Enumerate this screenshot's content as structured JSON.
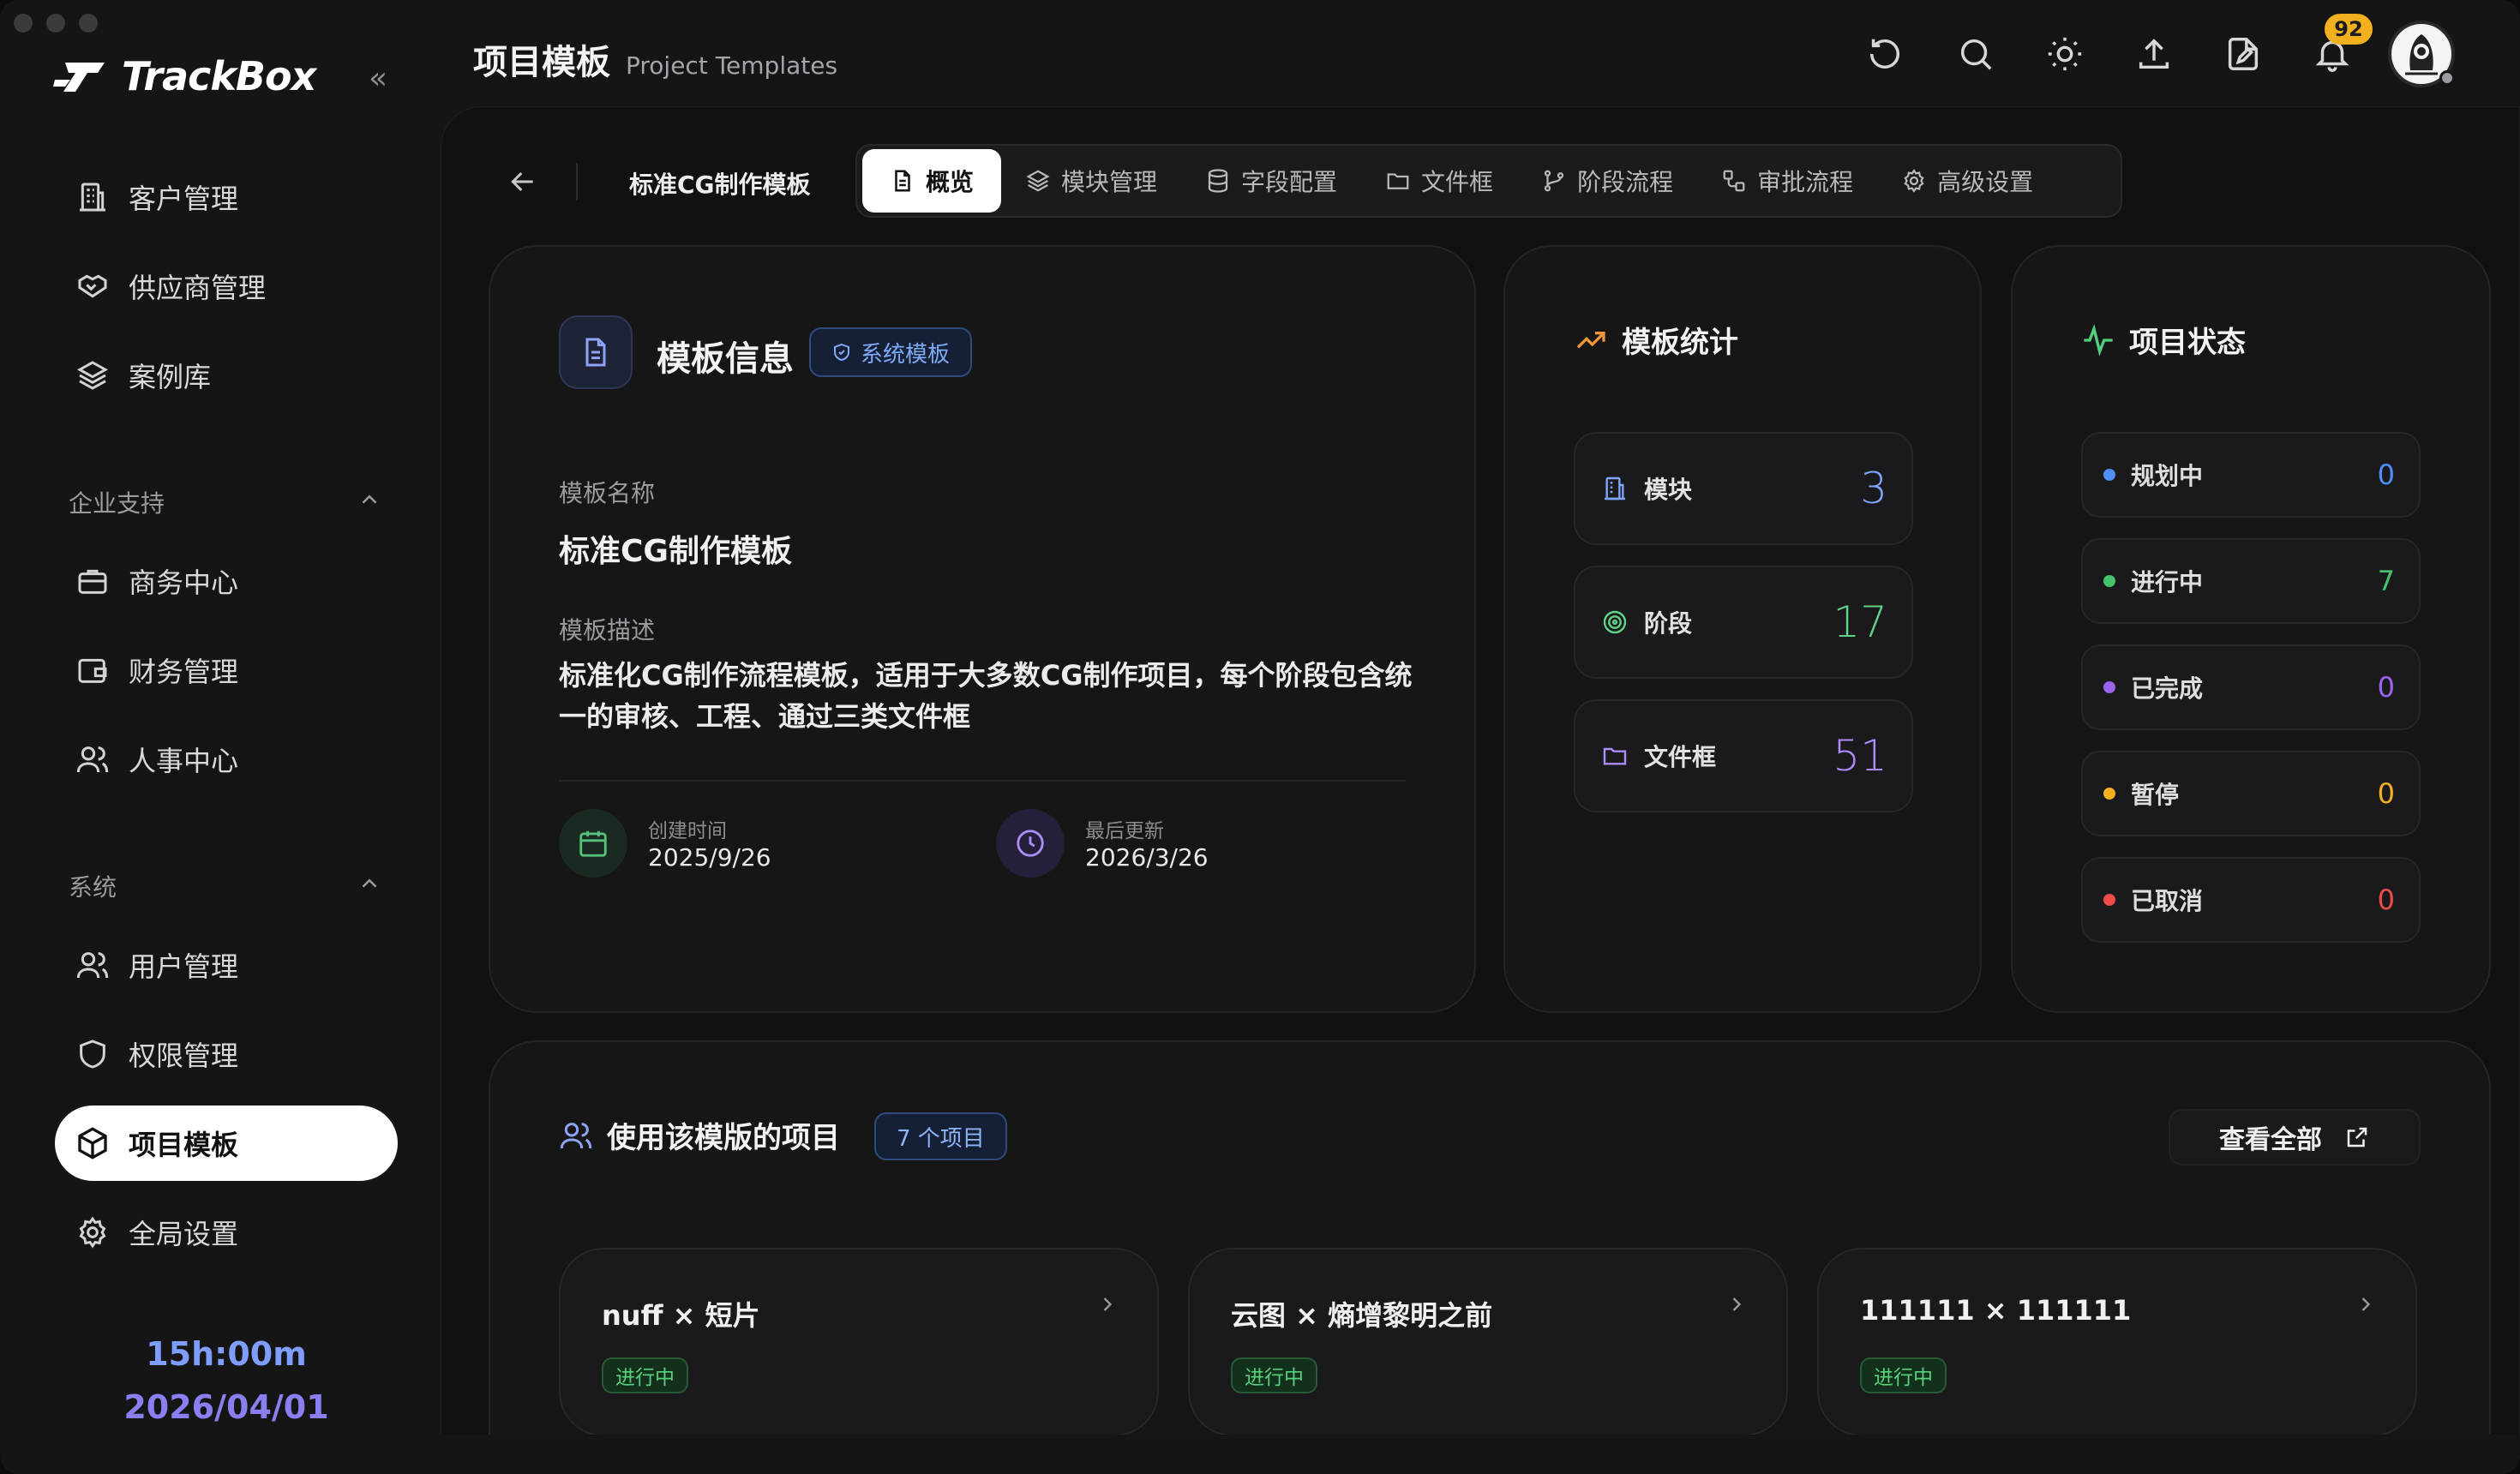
{
  "app": {
    "name": "TrackBox"
  },
  "sidebar": {
    "items_top": [
      {
        "label": "客户管理",
        "icon": "building-icon"
      },
      {
        "label": "供应商管理",
        "icon": "handshake-icon"
      },
      {
        "label": "案例库",
        "icon": "layers-icon"
      }
    ],
    "section_enterprise": "企业支持",
    "items_enterprise": [
      {
        "label": "商务中心",
        "icon": "briefcase-icon"
      },
      {
        "label": "财务管理",
        "icon": "wallet-icon"
      },
      {
        "label": "人事中心",
        "icon": "users-icon"
      }
    ],
    "section_system": "系统",
    "items_system": [
      {
        "label": "用户管理",
        "icon": "users-icon"
      },
      {
        "label": "权限管理",
        "icon": "shield-icon"
      },
      {
        "label": "项目模板",
        "icon": "box-icon",
        "active": true
      },
      {
        "label": "全局设置",
        "icon": "gear-icon"
      }
    ],
    "clock_time": "15h:00m",
    "clock_date": "2026/04/01"
  },
  "header": {
    "title_zh": "项目模板",
    "title_en": "Project Templates",
    "notification_count": "92",
    "icons": [
      "refresh-icon",
      "search-icon",
      "sun-icon",
      "upload-icon",
      "file-edit-icon",
      "bell-icon"
    ]
  },
  "breadcrumb": {
    "template_name": "标准CG制作模板"
  },
  "tabs": [
    {
      "label": "概览",
      "icon": "file-icon",
      "active": true
    },
    {
      "label": "模块管理",
      "icon": "layers-icon"
    },
    {
      "label": "字段配置",
      "icon": "database-icon"
    },
    {
      "label": "文件框",
      "icon": "folder-icon"
    },
    {
      "label": "阶段流程",
      "icon": "branch-icon"
    },
    {
      "label": "审批流程",
      "icon": "workflow-icon"
    },
    {
      "label": "高级设置",
      "icon": "gear-icon"
    }
  ],
  "info": {
    "title": "模板信息",
    "badge": "系统模板",
    "name_label": "模板名称",
    "name_value": "标准CG制作模板",
    "desc_label": "模板描述",
    "desc_value": "标准化CG制作流程模板，适用于大多数CG制作项目，每个阶段包含统一的审核、工程、通过三类文件框",
    "created_label": "创建时间",
    "created_value": "2025/9/26",
    "updated_label": "最后更新",
    "updated_value": "2026/3/26"
  },
  "stats": {
    "title": "模板统计",
    "rows": [
      {
        "label": "模块",
        "value": "3",
        "color": "#7ea6ff",
        "icon": "building-icon"
      },
      {
        "label": "阶段",
        "value": "17",
        "color": "#5fd38a",
        "icon": "target-icon"
      },
      {
        "label": "文件框",
        "value": "51",
        "color": "#b18cff",
        "icon": "folder-icon"
      }
    ]
  },
  "status": {
    "title": "项目状态",
    "rows": [
      {
        "label": "规划中",
        "value": "0",
        "color": "#4f8ff7"
      },
      {
        "label": "进行中",
        "value": "7",
        "color": "#45c26a"
      },
      {
        "label": "已完成",
        "value": "0",
        "color": "#9a63f0"
      },
      {
        "label": "暂停",
        "value": "0",
        "color": "#f2b01e"
      },
      {
        "label": "已取消",
        "value": "0",
        "color": "#ee4b4b"
      }
    ]
  },
  "projects": {
    "title": "使用该模版的项目",
    "count_badge": "7 个项目",
    "view_all": "查看全部",
    "items": [
      {
        "name": "nuff × 短片",
        "status": "进行中"
      },
      {
        "name": "云图 × 熵增黎明之前",
        "status": "进行中"
      },
      {
        "name": "111111 × 111111",
        "status": "进行中"
      }
    ]
  }
}
